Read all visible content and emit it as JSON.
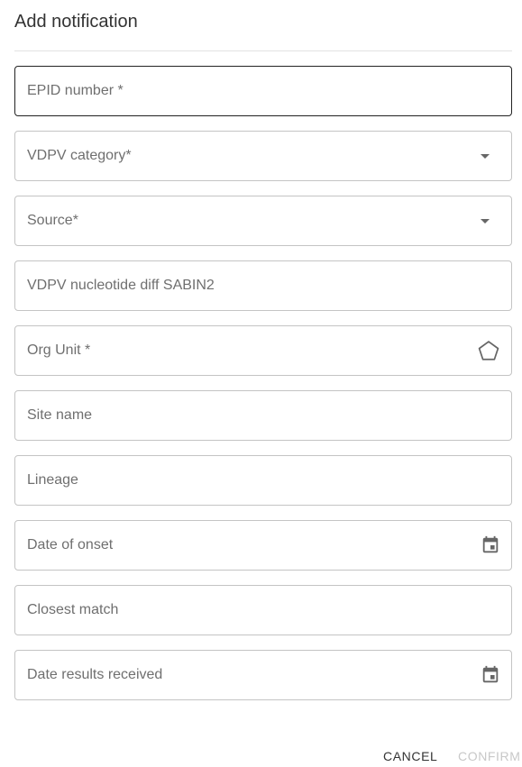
{
  "dialog": {
    "title": "Add notification"
  },
  "fields": [
    {
      "label": "EPID number *",
      "type": "text",
      "value": ""
    },
    {
      "label": "VDPV category*",
      "type": "select",
      "value": ""
    },
    {
      "label": "Source*",
      "type": "select",
      "value": ""
    },
    {
      "label": "VDPV nucleotide diff SABIN2",
      "type": "text",
      "value": ""
    },
    {
      "label": "Org Unit *",
      "type": "orgunit",
      "icon": "polygon-icon",
      "value": ""
    },
    {
      "label": "Site name",
      "type": "text",
      "value": ""
    },
    {
      "label": "Lineage",
      "type": "text",
      "value": ""
    },
    {
      "label": "Date of onset",
      "type": "date",
      "icon": "calendar-icon",
      "value": ""
    },
    {
      "label": "Closest match",
      "type": "text",
      "value": ""
    },
    {
      "label": "Date results received",
      "type": "date",
      "icon": "calendar-icon",
      "value": ""
    }
  ],
  "actions": {
    "cancel": "CANCEL",
    "confirm": "CONFIRM",
    "confirm_enabled": false
  },
  "colors": {
    "border": "#c4c4c4",
    "border_focused": "#222222",
    "label": "#6f6f6f",
    "disabled": "#c8c8c8"
  }
}
